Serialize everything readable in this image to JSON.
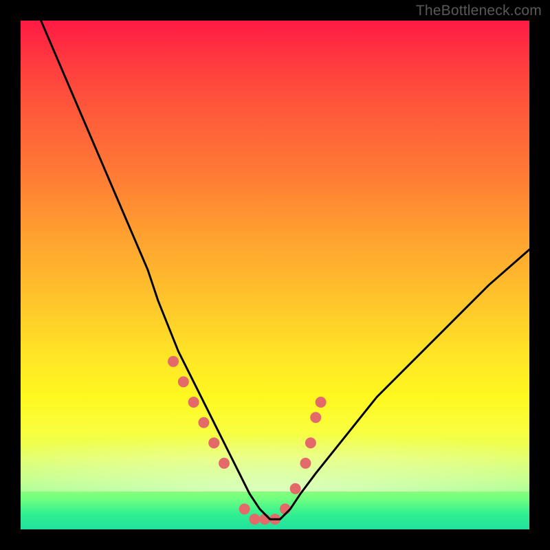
{
  "watermark": "TheBottleneck.com",
  "chart_data": {
    "type": "line",
    "title": "",
    "xlabel": "",
    "ylabel": "",
    "xlim": [
      0,
      100
    ],
    "ylim": [
      0,
      100
    ],
    "legend": false,
    "grid": false,
    "series": [
      {
        "name": "bottleneck-curve",
        "color": "#000000",
        "x": [
          4,
          7,
          10,
          13,
          16,
          19,
          22,
          25,
          27,
          29,
          31,
          33,
          35,
          37,
          39,
          41,
          43,
          45,
          47,
          49,
          51,
          53,
          55,
          58,
          62,
          66,
          70,
          75,
          80,
          86,
          92,
          100
        ],
        "values": [
          100,
          93,
          86,
          79,
          72,
          65,
          58,
          51,
          45,
          40,
          35,
          31,
          27,
          23,
          19,
          15,
          11,
          7,
          4,
          2,
          2,
          4,
          7,
          11,
          16,
          21,
          26,
          31,
          36,
          42,
          48,
          55
        ]
      }
    ],
    "markers": {
      "name": "highlight-dots",
      "color": "#e46a6a",
      "radius_px": 8,
      "x": [
        30,
        32,
        34,
        36,
        38,
        40,
        44,
        46,
        48,
        50,
        52,
        54,
        56,
        57,
        58,
        59
      ],
      "values": [
        33,
        29,
        25,
        21,
        17,
        13,
        4,
        2,
        2,
        2,
        4,
        8,
        13,
        17,
        22,
        25
      ]
    }
  }
}
